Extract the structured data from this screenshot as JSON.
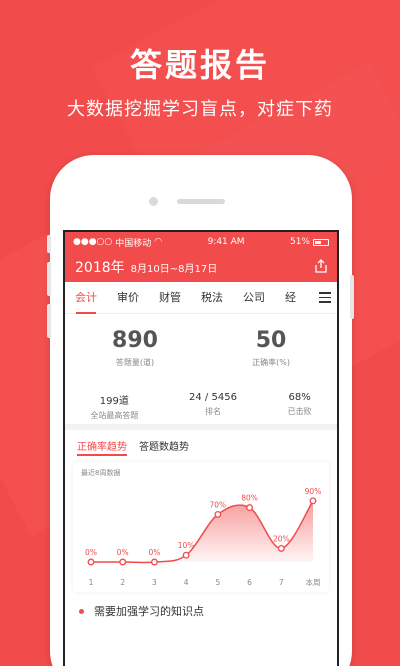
{
  "hero": {
    "title": "答题报告",
    "subtitle": "大数据挖掘学习盲点，对症下药"
  },
  "status_bar": {
    "carrier": "中国移动",
    "time": "9:41 AM",
    "battery": "51%"
  },
  "header": {
    "year": "2018年",
    "range": "8月10日~8月17日",
    "share_icon": "share-icon"
  },
  "tabs": [
    "会计",
    "审价",
    "财管",
    "税法",
    "公司",
    "经"
  ],
  "active_tab": 0,
  "summary": {
    "answered": {
      "value": "890",
      "label": "答题量(道)"
    },
    "accuracy": {
      "value": "50",
      "label": "正确率(%)"
    }
  },
  "details": [
    {
      "value": "199道",
      "label": "全站最高答题"
    },
    {
      "value": "24 / 5456",
      "label": "排名"
    },
    {
      "value": "68%",
      "label": "已击败"
    }
  ],
  "chart_tabs": [
    "正确率趋势",
    "答题数趋势"
  ],
  "chart_caption": "最近8周数据",
  "colors": {
    "accent": "#f24b4b"
  },
  "chart_data": {
    "type": "area",
    "categories": [
      "1",
      "2",
      "3",
      "4",
      "5",
      "6",
      "7",
      "本周"
    ],
    "values": [
      0,
      0,
      0,
      10,
      70,
      80,
      20,
      90
    ],
    "labels": [
      "0%",
      "0%",
      "0%",
      "10%",
      "70%",
      "80%",
      "20%",
      "90%"
    ],
    "ylim": [
      0,
      100
    ]
  },
  "tips": {
    "label": "需要加强学习的知识点"
  }
}
